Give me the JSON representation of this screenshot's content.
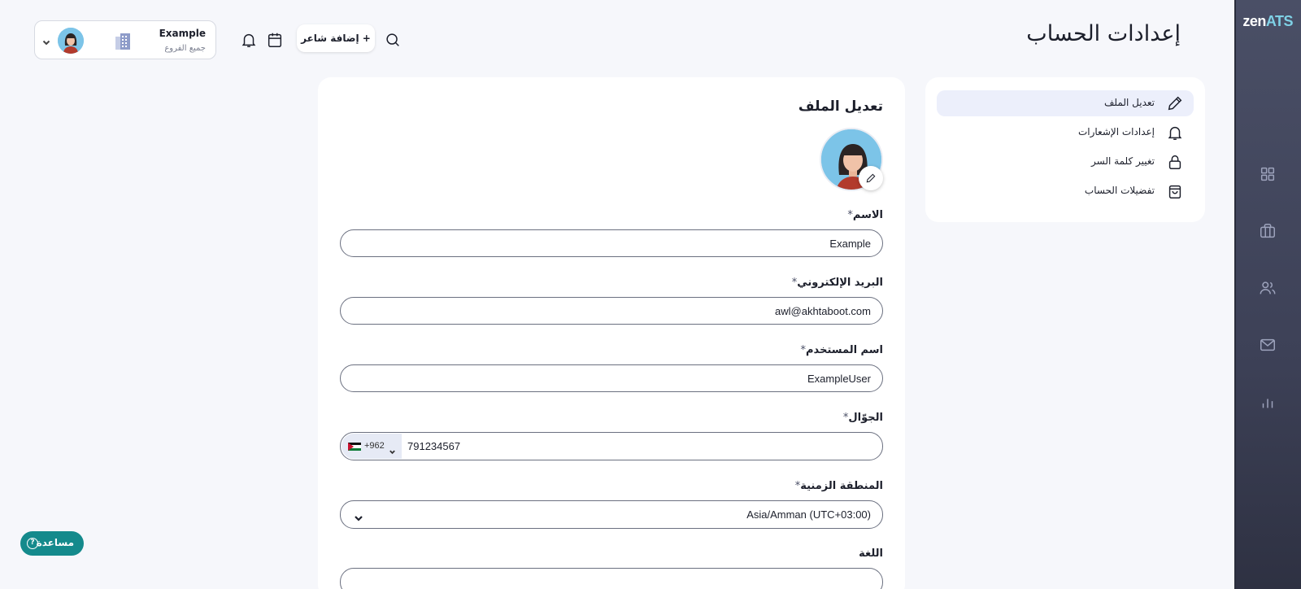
{
  "app": {
    "logo_part1": "zen",
    "logo_part2": "ATS"
  },
  "page": {
    "title": "إعدادات الحساب"
  },
  "header": {
    "user_name": "Example",
    "branch_label": "جميع الفروع",
    "add_poet_label": "+ إضافة شاعر"
  },
  "icons": {
    "rail": [
      "dashboard-icon",
      "briefcase-icon",
      "users-icon",
      "mail-icon",
      "chart-icon"
    ],
    "toolbar": [
      "search-icon",
      "calendar-icon",
      "bell-icon"
    ]
  },
  "settings_menu": {
    "items": [
      {
        "label": "تعديل الملف",
        "icon": "pencil-icon",
        "active": true
      },
      {
        "label": "إعدادات الإشعارات",
        "icon": "bell-icon",
        "active": false
      },
      {
        "label": "تغيير كلمة السر",
        "icon": "lock-icon",
        "active": false
      },
      {
        "label": "تفضيلات الحساب",
        "icon": "shopping-bag-icon",
        "active": false
      }
    ]
  },
  "form": {
    "title": "تعديل الملف",
    "required_mark": "*",
    "name": {
      "label": "الاسم",
      "value": "Example"
    },
    "email": {
      "label": "البريد الإلكتروني",
      "value": "awl@akhtaboot.com"
    },
    "username": {
      "label": "اسم المستخدم",
      "value": "ExampleUser"
    },
    "mobile": {
      "label": "الجوّال",
      "country_code": "+962",
      "value": "791234567"
    },
    "timezone": {
      "label": "المنطقة الزمنية",
      "value": "Asia/Amman (UTC+03:00)"
    },
    "language": {
      "label": "اللغة"
    }
  },
  "help": {
    "label": "مساعدة",
    "icon_glyph": "?"
  },
  "colors": {
    "accent_help": "#148a8c",
    "active_menu_bg": "#eceffb",
    "rail_bg": "#3d4157",
    "logo_accent": "#7fd1e6"
  }
}
